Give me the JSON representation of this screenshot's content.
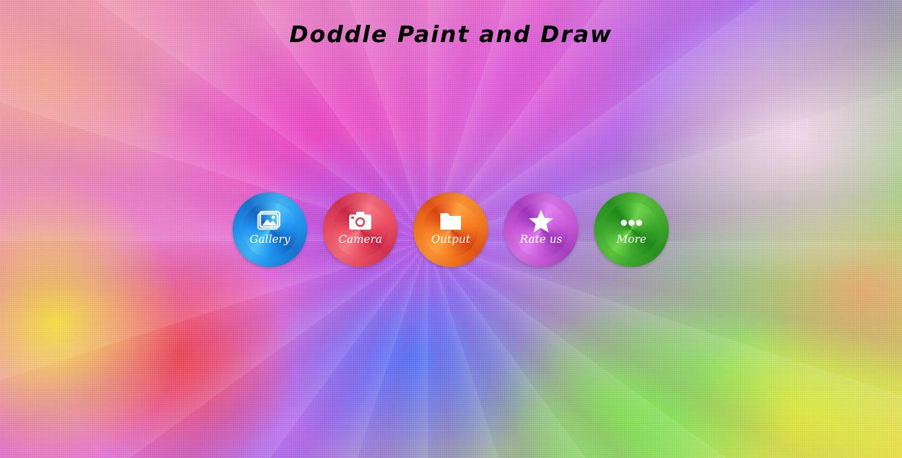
{
  "app": {
    "title": "Doddle Paint and Draw"
  },
  "menu": {
    "items": [
      {
        "id": "gallery",
        "label": "Gallery",
        "icon": "image-icon",
        "color": "#2196f3",
        "dark": "#1565c0",
        "light": "#4fc3f7"
      },
      {
        "id": "camera",
        "label": "Camera",
        "icon": "camera-icon",
        "color": "#ec4f63",
        "dark": "#c62848",
        "light": "#f47a86"
      },
      {
        "id": "output",
        "label": "Output",
        "icon": "folder-icon",
        "color": "#f57c1f",
        "dark": "#d84315",
        "light": "#ffa040"
      },
      {
        "id": "rate-us",
        "label": "Rate us",
        "icon": "star-icon",
        "color": "#c85ad8",
        "dark": "#9c35b8",
        "light": "#e080f0"
      },
      {
        "id": "more",
        "label": "More",
        "icon": "more-dots-icon",
        "color": "#3fa92e",
        "dark": "#1f8a1a",
        "light": "#6cd44a"
      }
    ]
  }
}
